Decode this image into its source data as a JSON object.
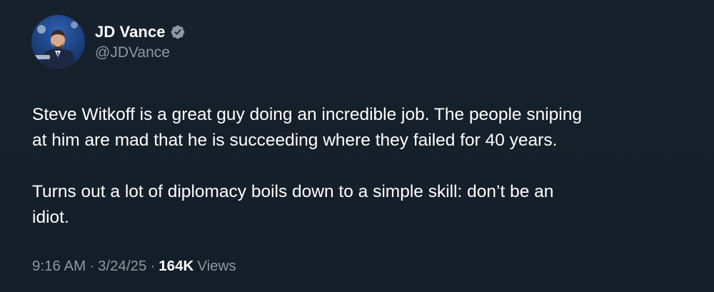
{
  "author": {
    "display_name": "JD Vance",
    "handle": "@JDVance",
    "verified_icon": "verified-badge-icon",
    "verified_color": "#8b98a5"
  },
  "tweet": {
    "paragraphs": [
      "Steve Witkoff is a great guy doing an incredible job. The people sniping\nat him are mad that he is succeeding where they failed for 40 years.",
      "Turns out a lot of diplomacy boils down to a simple skill: don’t be an\nidiot."
    ]
  },
  "meta": {
    "time": "9:16 AM",
    "date": "3/24/25",
    "separator": "·",
    "views_count": "164K",
    "views_label": "Views"
  },
  "colors": {
    "background": "#15202b",
    "primary_text": "#ffffff",
    "secondary_text": "#8b98a5"
  }
}
